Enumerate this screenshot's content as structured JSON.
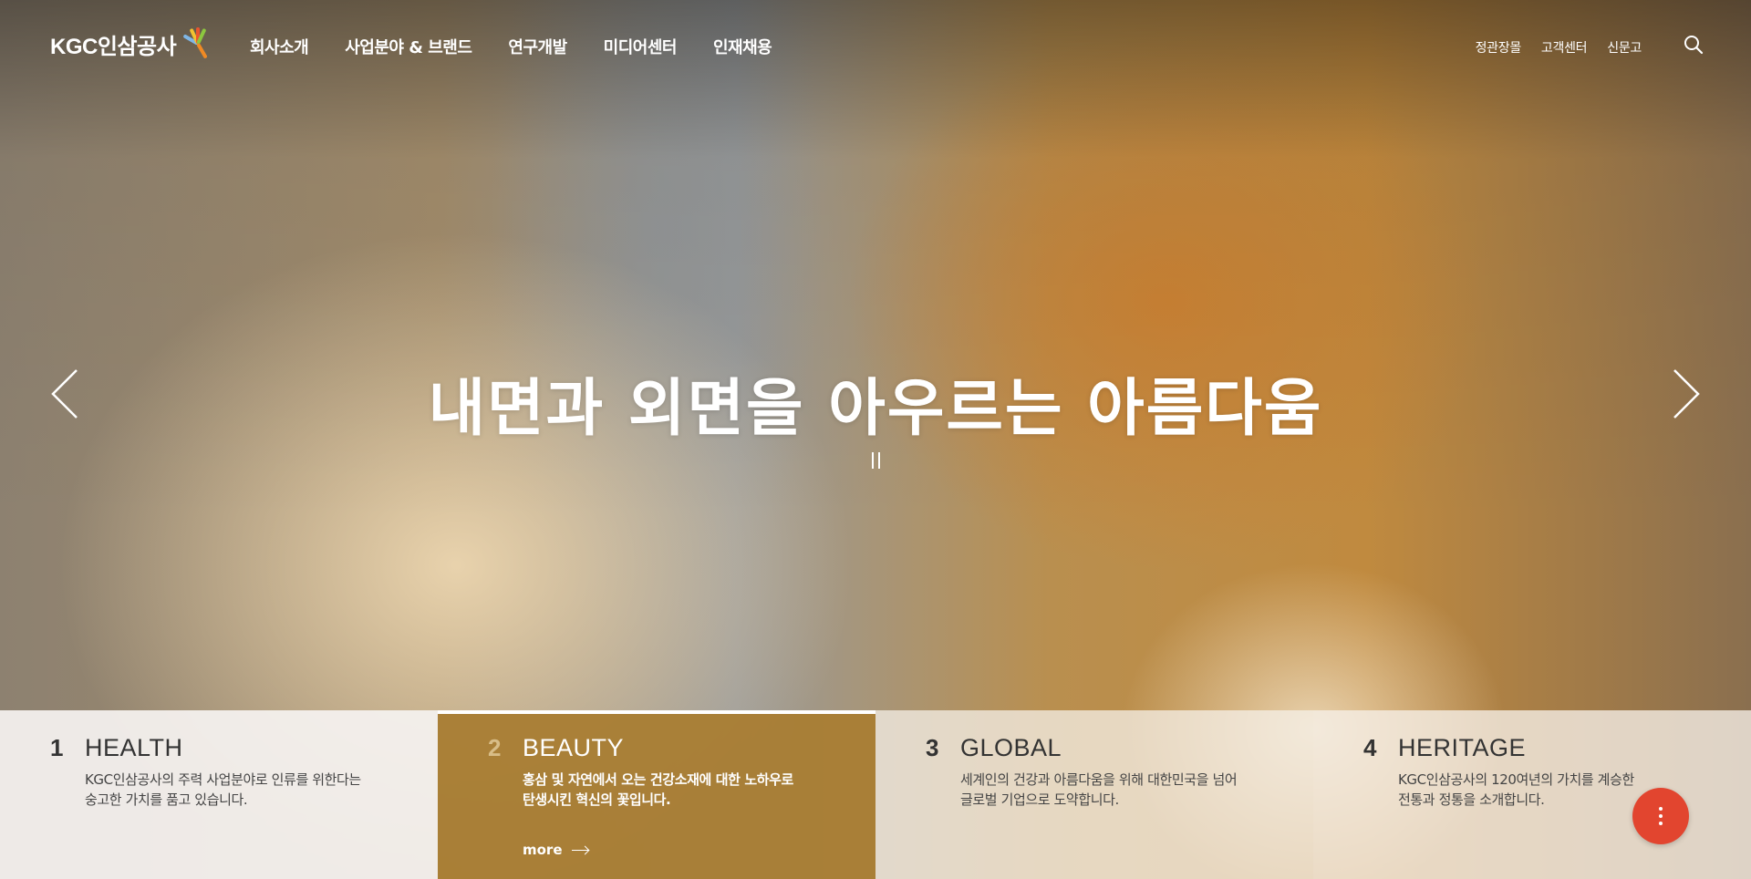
{
  "brand": {
    "logo_text": "KGC인삼공사"
  },
  "gnb": [
    {
      "label": "회사소개"
    },
    {
      "label": "사업분야 & 브랜드"
    },
    {
      "label": "연구개발"
    },
    {
      "label": "미디어센터"
    },
    {
      "label": "인재채용"
    }
  ],
  "util": [
    {
      "label": "정관장몰"
    },
    {
      "label": "고객센터"
    },
    {
      "label": "신문고"
    }
  ],
  "icons": {
    "search": "search-icon",
    "prev": "chevron-left-icon",
    "next": "chevron-right-icon",
    "pause": "pause-icon",
    "more": "arrow-right-icon",
    "fab": "more-vertical-icon"
  },
  "hero": {
    "headline": "내면과 외면을 아우르는 아름다움"
  },
  "panels": [
    {
      "num": "1",
      "title": "HEALTH",
      "desc1": "KGC인삼공사의 주력 사업분야로 인류를 위한다는",
      "desc2": "숭고한 가치를 품고 있습니다."
    },
    {
      "num": "2",
      "title": "BEAUTY",
      "desc1": "홍삼 및 자연에서 오는 건강소재에 대한 노하우로",
      "desc2": "탄생시킨 혁신의 꽃입니다.",
      "more": "more"
    },
    {
      "num": "3",
      "title": "GLOBAL",
      "desc1": "세계인의 건강과 아름다움을 위해 대한민국을 넘어",
      "desc2": "글로벌 기업으로 도약합니다."
    },
    {
      "num": "4",
      "title": "HERITAGE",
      "desc1": "KGC인삼공사의 120여년의 가치를 계승한",
      "desc2": "전통과 정통을 소개합니다."
    }
  ],
  "colors": {
    "accent": "#e2452f",
    "beauty_panel": "#a97e34"
  }
}
